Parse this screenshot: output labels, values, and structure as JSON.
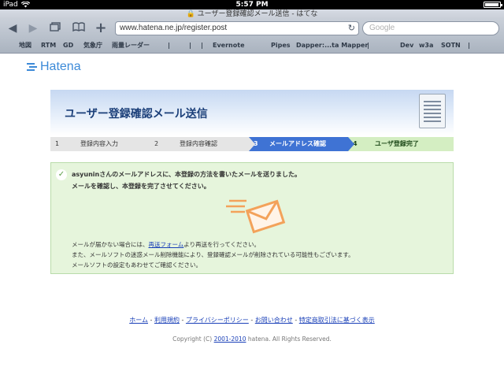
{
  "status_bar": {
    "device": "iPad",
    "time": "5:57 PM"
  },
  "browser": {
    "title": "ユーザー登録確認メール送信 - はてな",
    "url": "www.hatena.ne.jp/register.post",
    "search_placeholder": "Google",
    "bookmarks": [
      "地図",
      "RTM",
      "GD",
      "気象庁",
      "雨量レーダー",
      "|",
      "|",
      "|",
      "Evernote",
      "Pipes",
      "Dapper:...ta Mapper",
      "|",
      "Dev",
      "w3a",
      "SOTN",
      "|"
    ]
  },
  "logo": {
    "text": "Hatena"
  },
  "page": {
    "title": "ユーザー登録確認メール送信"
  },
  "steps": [
    {
      "num": "1",
      "label": "登録内容入力"
    },
    {
      "num": "2",
      "label": "登録内容確認"
    },
    {
      "num": "3",
      "label": "メールアドレス確認"
    },
    {
      "num": "4",
      "label": "ユーザ登録完了"
    }
  ],
  "message": {
    "line1": "asyuninさんのメールアドレスに、本登録の方法を書いたメールを送りました。",
    "line2": "メールを確認し、本登録を完了させてください。"
  },
  "note": {
    "line1_prefix": "メールが届かない場合には、",
    "line1_link": "再送フォーム",
    "line1_suffix": "より再送を行ってください。",
    "line2": "また、メールソフトの迷惑メール削除機能により、登録確認メールが削除されている可能性もございます。",
    "line3": "メールソフトの設定もあわせてご確認ください。"
  },
  "footer": {
    "links": [
      "ホーム",
      "利用規約",
      "プライバシーポリシー",
      "お問い合わせ",
      "特定商取引法に基づく表示"
    ],
    "separator": " - ",
    "copyright_prefix": "Copyright (C) ",
    "copyright_years": "2001-2010",
    "copyright_suffix": " hatena. All Rights Reserved."
  },
  "colors": {
    "accent": "#3f73d4",
    "success_bg": "#e6f5dc",
    "logo": "#3c8ad8",
    "envelope": "#f3a25a"
  }
}
